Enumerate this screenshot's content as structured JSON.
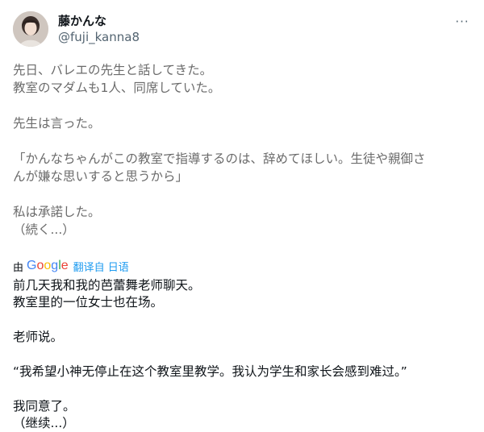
{
  "author": {
    "display_name": "藤かんな",
    "handle": "@fuji_kanna8",
    "avatar_icon": "profile-photo"
  },
  "more_icon": "more-options-icon",
  "original_text": {
    "line1": "先日、バレエの先生と話してきた。",
    "line2": "教室のマダムも1人、同席していた。",
    "line3": "先生は言った。",
    "line4": "「かんなちゃんがこの教室で指導するのは、辞めてほしい。生徒や親御さ",
    "line5": "んが嫌な思いすると思うから」",
    "line6": "私は承諾した。",
    "line7": "（続く...）"
  },
  "translation_bar": {
    "by_label": "由",
    "google_logo": "Google",
    "translated_from": "翻译自 日语"
  },
  "translated_text": {
    "line1": "前几天我和我的芭蕾舞老师聊天。",
    "line2": "教室里的一位女士也在场。",
    "line3": "老师说。",
    "line4": "“我希望小神无停止在这个教室里教学。我认为学生和家长会感到难过。”",
    "line5": "我同意了。",
    "line6": "（继续...）"
  },
  "colors": {
    "text_primary": "#0f1419",
    "text_secondary": "#536471",
    "link_blue": "#1d9bf0"
  }
}
